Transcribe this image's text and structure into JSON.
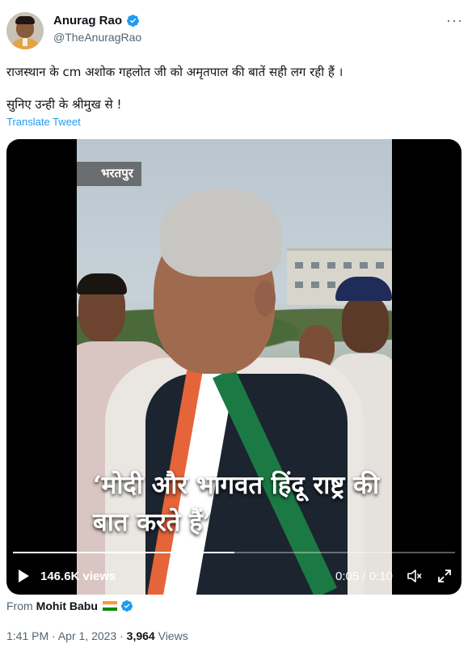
{
  "author": {
    "display_name": "Anurag Rao",
    "handle": "@TheAnuragRao",
    "verified_icon": "verified-badge-icon"
  },
  "tweet": {
    "line1": "राजस्थान के cm अशोक गहलोत जी को अमृतपाल की बातें सही लग रही हैं ।",
    "line2": "सुनिए उन्ही के श्रीमुख से !",
    "translate_label": "Translate Tweet"
  },
  "video": {
    "location_badge": "भरतपुर",
    "caption": "‘मोदी और भागवत हिंदू राष्ट्र की बात करते हैं’",
    "views": "146.6K views",
    "time": "0:05 / 0:10",
    "progress": 0.5
  },
  "source": {
    "from_label": "From",
    "from_name": "Mohit Babu"
  },
  "footer": {
    "time": "1:41 PM",
    "date": "Apr 1, 2023",
    "separator": "·",
    "views_count": "3,964",
    "views_label": "Views"
  },
  "colors": {
    "accent": "#1d9bf0",
    "secondary_text": "#536471"
  }
}
